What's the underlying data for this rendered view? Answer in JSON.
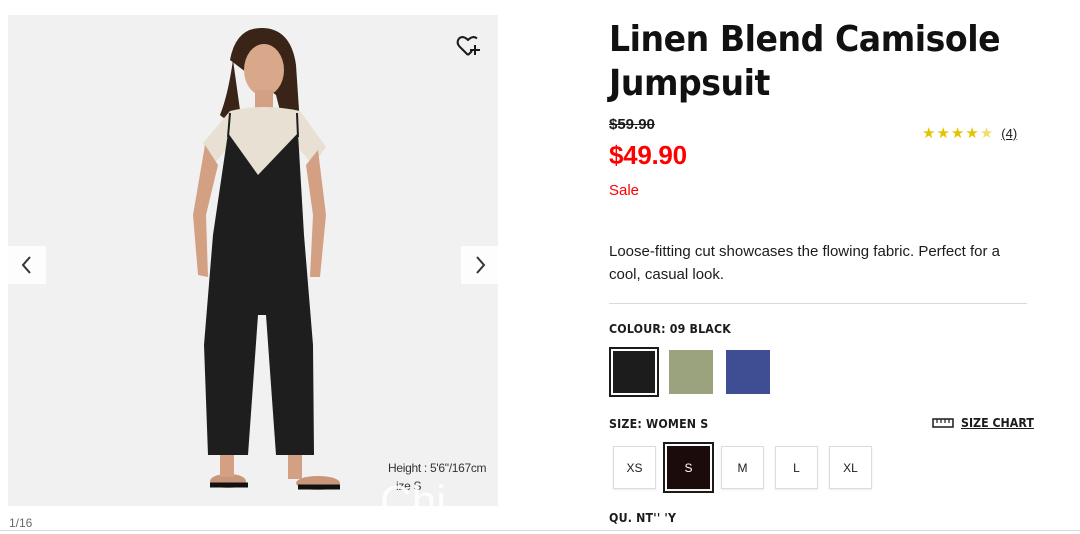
{
  "product": {
    "title": "Linen Blend Camisole Jumpsuit",
    "original_price": "$59.90",
    "sale_price": "$49.90",
    "sale_label": "Sale",
    "rating": {
      "stars": 4.5,
      "review_count": "(4)"
    },
    "description": "Loose-fitting cut showcases the flowing fabric. Perfect for a cool, casual look."
  },
  "gallery": {
    "model_height": "Height : 5'6\"/167cm",
    "model_size": "ize  S",
    "watermark": "Chi",
    "counter": "1/16",
    "prev_icon": "chevron-left-icon",
    "next_icon": "chevron-right-icon",
    "wishlist_icon": "heart-plus-icon"
  },
  "colour": {
    "label": "COLOUR: 09 BLACK",
    "options": [
      {
        "name": "black",
        "hex": "#1c1c1c",
        "selected": true
      },
      {
        "name": "olive",
        "hex": "#9aa27e",
        "selected": false
      },
      {
        "name": "blue",
        "hex": "#3f4e93",
        "selected": false
      }
    ]
  },
  "size": {
    "label": "SIZE: WOMEN S",
    "chart_label": "SIZE CHART",
    "chart_icon": "ruler-icon",
    "options": [
      {
        "label": "XS",
        "selected": false
      },
      {
        "label": "S",
        "selected": true
      },
      {
        "label": "M",
        "selected": false
      },
      {
        "label": "L",
        "selected": false
      },
      {
        "label": "XL",
        "selected": false
      }
    ]
  },
  "quantity": {
    "label": "QU. NT'' 'Y"
  }
}
